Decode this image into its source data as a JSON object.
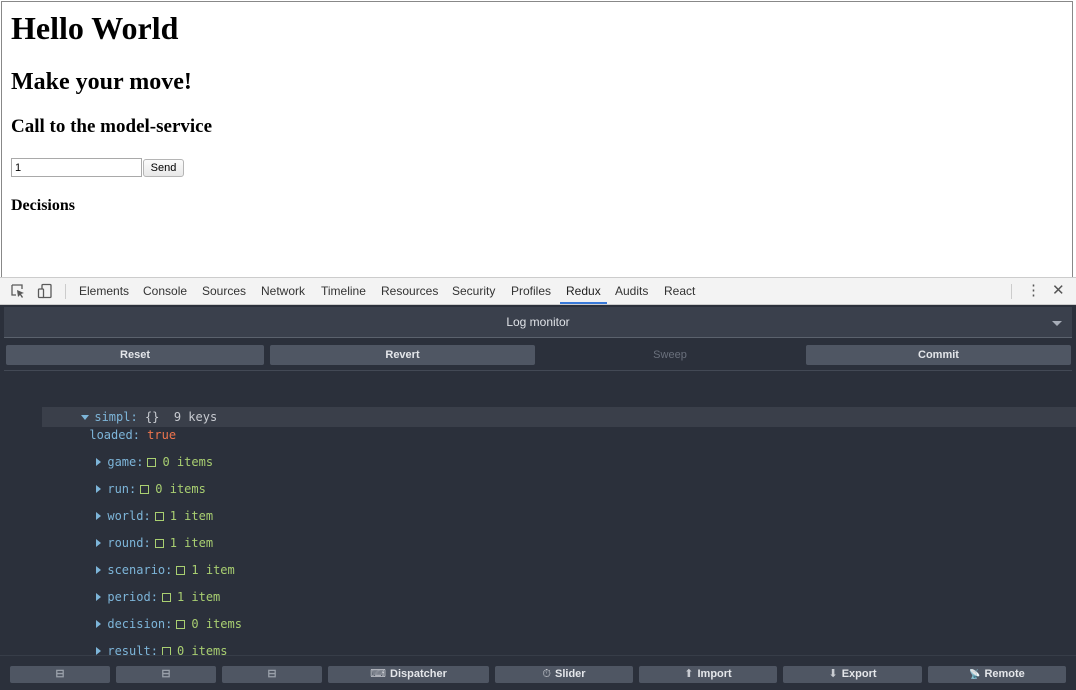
{
  "page": {
    "title": "Hello World",
    "subtitle": "Make your move!",
    "service_heading": "Call to the model-service",
    "input_value": "1",
    "send_label": "Send",
    "decisions_heading": "Decisions"
  },
  "devtools": {
    "tabs": [
      "Elements",
      "Console",
      "Sources",
      "Network",
      "Timeline",
      "Resources",
      "Security",
      "Profiles",
      "Redux",
      "Audits",
      "React"
    ],
    "active_tab": "Redux",
    "icons": {
      "inspect": "inspect-element-icon",
      "device": "device-mode-icon",
      "more": "more-vertical-icon",
      "close": "close-icon"
    },
    "more_glyph": "⋮",
    "close_glyph": "✕"
  },
  "redux": {
    "monitor_title": "Log monitor",
    "controls": {
      "reset": "Reset",
      "revert": "Revert",
      "sweep": "Sweep",
      "commit": "Commit"
    },
    "tree": {
      "root_key": "simpl:",
      "root_brace": "{}",
      "root_count": "9 keys",
      "loaded_key": "loaded:",
      "loaded_value": "true",
      "children": [
        {
          "key": "game:",
          "count": "0 items"
        },
        {
          "key": "run:",
          "count": "0 items"
        },
        {
          "key": "world:",
          "count": "1 item"
        },
        {
          "key": "round:",
          "count": "1 item"
        },
        {
          "key": "scenario:",
          "count": "1 item"
        },
        {
          "key": "period:",
          "count": "1 item"
        },
        {
          "key": "decision:",
          "count": "0 items"
        },
        {
          "key": "result:",
          "count": "0 items"
        }
      ]
    },
    "bottom_buttons": {
      "b1_icon": "⊟",
      "b2_icon": "⊟",
      "b3_icon": "⊟",
      "dispatcher": "Dispatcher",
      "dispatcher_icon": "⌨",
      "slider": "Slider",
      "slider_icon": "⏱",
      "import": "Import",
      "import_icon": "⬆",
      "export": "Export",
      "export_icon": "⬇",
      "remote": "Remote",
      "remote_icon": "📡"
    }
  },
  "colors": {
    "panel_bg": "#2b303b",
    "key": "#7db5d9",
    "bool": "#f0754d",
    "count": "#a9cf71",
    "active_tab_underline": "#3879d9"
  }
}
